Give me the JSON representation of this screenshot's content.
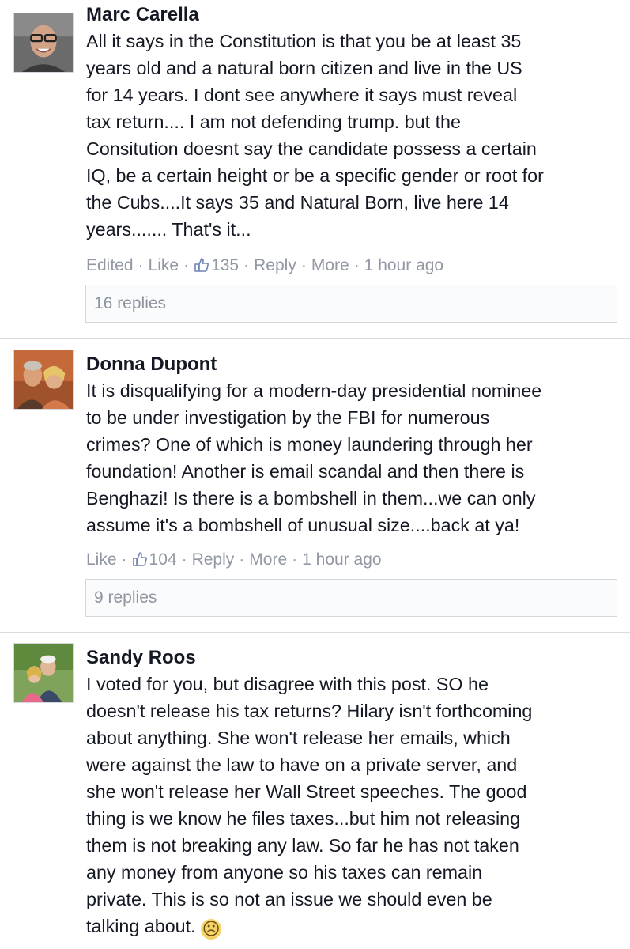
{
  "comments": [
    {
      "name": "Marc Carella",
      "text": "All it says in the Constitution is that you be at least 35\nyears old and a natural born citizen and live in the US\nfor 14 years. I dont see anywhere it says must reveal\ntax return.... I am not defending trump. but the\nConsitution doesnt say the candidate possess a certain\nIQ, be a certain height or be a specific gender or root for\nthe Cubs....It says 35 and Natural Born, live here 14\nyears....... That's it...",
      "edited": "Edited",
      "like": "Like",
      "likes": "135",
      "reply": "Reply",
      "more": "More",
      "time": "1 hour ago",
      "replies": "16 replies"
    },
    {
      "name": "Donna Dupont",
      "text": "It is disqualifying for a modern-day presidential nominee\nto be under investigation by the FBI for numerous\ncrimes? One of which is money laundering through her\nfoundation! Another is email scandal and then there is\nBenghazi! Is there is a bombshell in them...we can only\nassume it's a bombshell of unusual size....back at ya!",
      "like": "Like",
      "likes": "104",
      "reply": "Reply",
      "more": "More",
      "time": "1 hour ago",
      "replies": "9 replies"
    },
    {
      "name": "Sandy Roos",
      "text": "I voted for you, but disagree with this post. SO he\ndoesn't release his tax returns? Hilary isn't forthcoming\nabout anything. She won't release her emails, which\nwere against the law to have on a private server, and\nshe won't release her Wall Street speeches. The good\nthing is we know he files taxes...but him not releasing\nthem is not breaking any law. So far he has not taken\nany money from anyone so his taxes can remain\nprivate. This is so not an issue we should even be\ntalking about.",
      "emoji": "☹"
    }
  ],
  "separator": "·",
  "colors": {
    "meta_gray": "#9197a3",
    "name_text": "#141823",
    "border": "#d3d6db"
  }
}
